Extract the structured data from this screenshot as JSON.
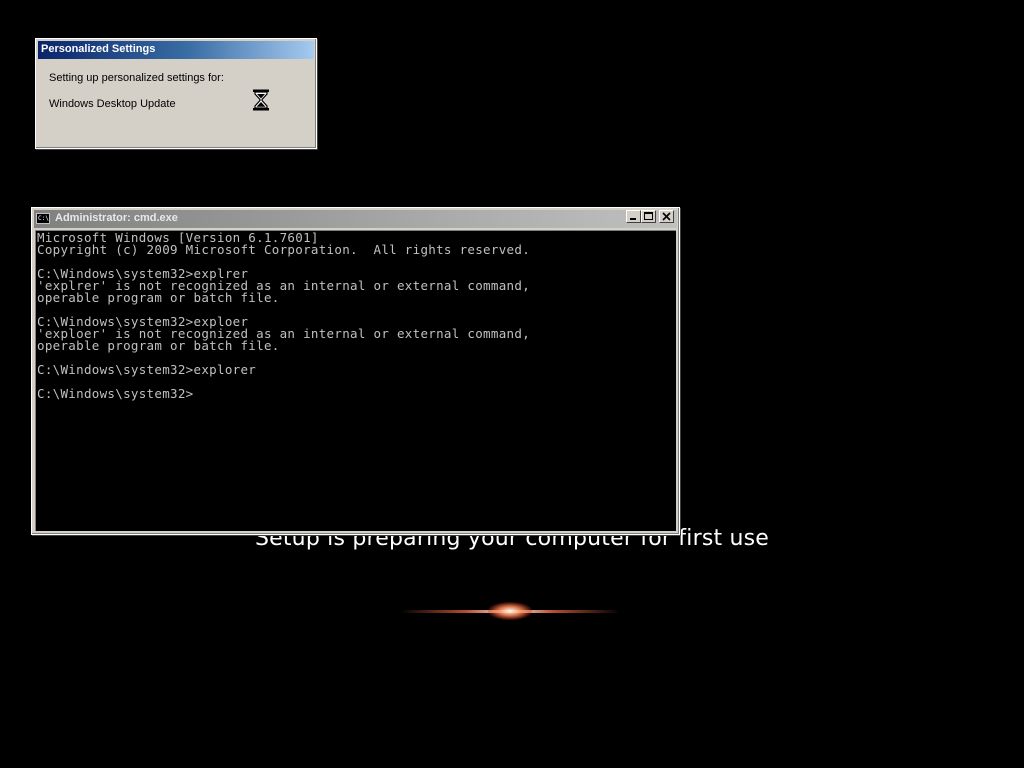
{
  "personalize_dialog": {
    "title": "Personalized Settings",
    "message": "Setting up personalized settings for:",
    "component": "Windows Desktop Update",
    "icon": "hourglass-icon"
  },
  "cmd_window": {
    "title": "Administrator: cmd.exe",
    "icon": "cmd-icon",
    "icon_text": "C:\\",
    "buttons": [
      "minimize",
      "maximize",
      "close"
    ],
    "output_lines": [
      "Microsoft Windows [Version 6.1.7601]",
      "Copyright (c) 2009 Microsoft Corporation.  All rights reserved.",
      "",
      "C:\\Windows\\system32>explrer",
      "'explrer' is not recognized as an internal or external command,",
      "operable program or batch file.",
      "",
      "C:\\Windows\\system32>exploer",
      "'exploer' is not recognized as an internal or external command,",
      "operable program or batch file.",
      "",
      "C:\\Windows\\system32>explorer",
      "",
      "C:\\Windows\\system32>"
    ]
  },
  "setup": {
    "status": "Setup is preparing your computer for first use"
  },
  "colors": {
    "background": "#000000",
    "console_text": "#c0c0c0",
    "dialog_title_start": "#0a246a",
    "dialog_title_end": "#a6caf0",
    "window_face": "#d4d0c8"
  }
}
